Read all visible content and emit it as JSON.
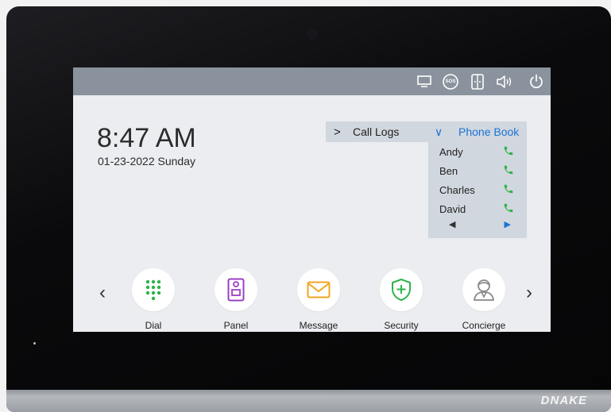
{
  "status_bar": {
    "icons": [
      "monitor-icon",
      "sos-icon",
      "unlock-icon",
      "volume-icon",
      "power-icon"
    ],
    "sos_label": "SOS"
  },
  "clock": {
    "time": "8:47 AM",
    "date": "01-23-2022 Sunday"
  },
  "call_logs": {
    "label": "Call Logs",
    "chevron": ">"
  },
  "phone_book": {
    "label": "Phone Book",
    "chevron": "∨",
    "contacts": [
      "Andy",
      "Ben",
      "Charles",
      "David"
    ],
    "prev": "◀",
    "next": "▶"
  },
  "apps": [
    {
      "label": "Dial",
      "icon": "dialpad-icon",
      "color": "#2fb24a"
    },
    {
      "label": "Panel",
      "icon": "door-panel-icon",
      "color": "#9b3fc5"
    },
    {
      "label": "Message",
      "icon": "envelope-icon",
      "color": "#f2a61f"
    },
    {
      "label": "Security",
      "icon": "shield-plus-icon",
      "color": "#2fb24a"
    },
    {
      "label": "Concierge",
      "icon": "concierge-icon",
      "color": "#888888"
    }
  ],
  "nav": {
    "prev": "‹",
    "next": "›"
  },
  "brand": "DNAKE",
  "colors": {
    "status_bar": "#8a939d",
    "screen_bg": "#ebedf0",
    "highlight": "#1a73d6",
    "call_green": "#2fb24a"
  }
}
